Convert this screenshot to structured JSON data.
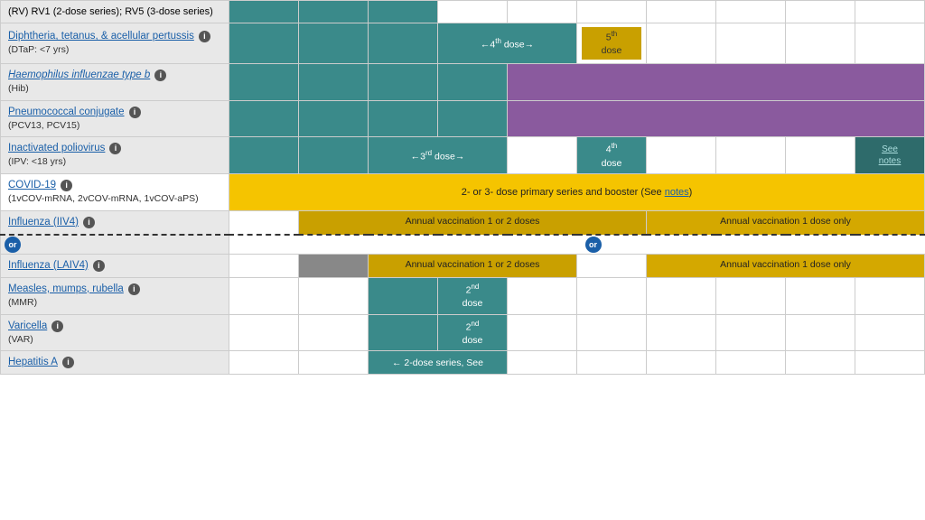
{
  "vaccines": [
    {
      "id": "rv",
      "name": "(RV) RV1 (2-dose series); RV5 (3-dose series)",
      "nameLink": false,
      "sub": null
    },
    {
      "id": "dtap",
      "name": "Diphtheria, tetanus, & acellular pertussis",
      "nameLink": true,
      "sub": "(DTaP: <7 yrs)",
      "infoIcon": true,
      "dose4Label": "←4th dose→",
      "dose5Label": "5th dose"
    },
    {
      "id": "hib",
      "name": "Haemophilus influenzae type b",
      "nameLink": true,
      "italic": true,
      "sub": "(Hib)",
      "infoIcon": true
    },
    {
      "id": "pcv",
      "name": "Pneumococcal conjugate",
      "nameLink": true,
      "sub": "(PCV13, PCV15)",
      "infoIcon": true
    },
    {
      "id": "ipv",
      "name": "Inactivated poliovirus",
      "nameLink": true,
      "sub": "(IPV: <18 yrs)",
      "infoIcon": true,
      "dose3Label": "←3rd dose→",
      "dose4Label": "4th dose",
      "seeNotes": "See notes"
    },
    {
      "id": "covid",
      "name": "COVID-19",
      "nameLink": true,
      "sub": "(1vCOV-mRNA, 2vCOV-mRNA, 1vCOV-aPS)",
      "infoIcon": true,
      "seriesText": "2- or 3- dose primary series and booster (See ",
      "notesText": "notes",
      "seriesTextEnd": ")"
    },
    {
      "id": "iiv4",
      "name": "Influenza (IIV4)",
      "nameLink": true,
      "infoIcon": true,
      "annualText1": "Annual vaccination 1 or 2 doses",
      "annualText2": "Annual vaccination 1 dose only"
    },
    {
      "id": "laiv4",
      "name": "Influenza (LAIV4)",
      "nameLink": true,
      "infoIcon": true,
      "annualText1": "Annual vaccination 1 or 2 doses",
      "annualText2": "Annual vaccination 1 dose only"
    },
    {
      "id": "mmr",
      "name": "Measles, mumps, rubella",
      "nameLink": true,
      "sub": "(MMR)",
      "infoIcon": true,
      "dose2Label": "2nd dose"
    },
    {
      "id": "varicella",
      "name": "Varicella",
      "nameLink": true,
      "sub": "(VAR)",
      "infoIcon": true,
      "dose2Label": "2nd dose"
    },
    {
      "id": "hepa",
      "name": "Hepatitis A",
      "nameLink": true,
      "infoIcon": true,
      "seriesText": "← 2-dose series, See"
    }
  ]
}
